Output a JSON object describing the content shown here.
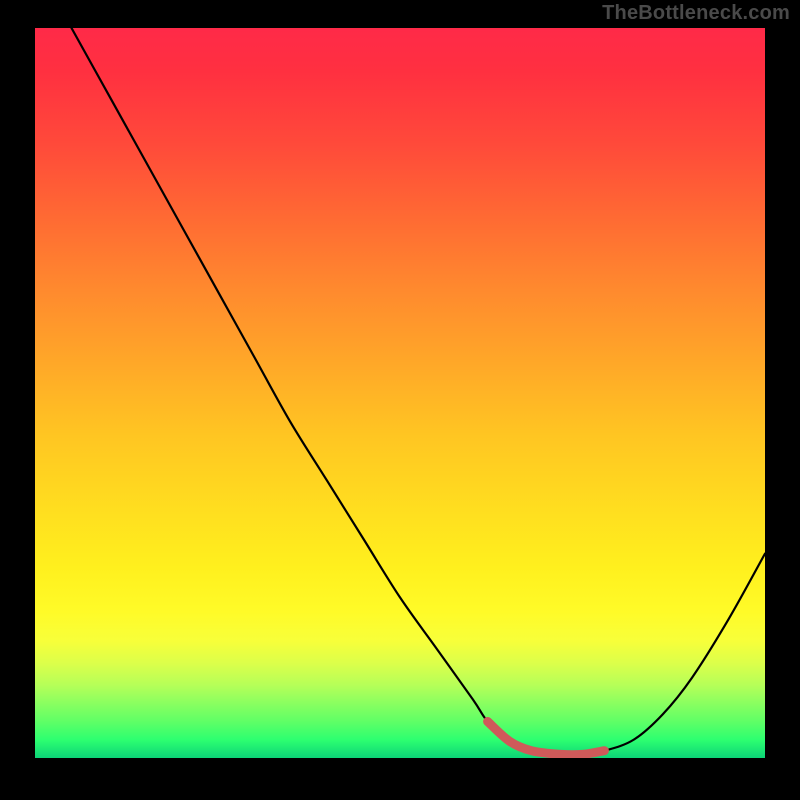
{
  "watermark": "TheBottleneck.com",
  "colors": {
    "background": "#000000",
    "gradient_top": "#ff2a48",
    "gradient_bottom": "#0cd477",
    "curve": "#000000",
    "trough_highlight": "#cf5a5a"
  },
  "chart_data": {
    "type": "line",
    "title": "",
    "xlabel": "",
    "ylabel": "",
    "xlim": [
      0,
      100
    ],
    "ylim": [
      0,
      100
    ],
    "x": [
      5,
      10,
      15,
      20,
      25,
      30,
      35,
      40,
      45,
      50,
      55,
      60,
      62,
      65,
      68,
      72,
      75,
      78,
      82,
      86,
      90,
      95,
      100
    ],
    "values": [
      100,
      91,
      82,
      73,
      64,
      55,
      46,
      38,
      30,
      22,
      15,
      8,
      5,
      2.3,
      1.0,
      0.5,
      0.5,
      1.0,
      2.5,
      6,
      11,
      19,
      28
    ],
    "trough_segment": {
      "x": [
        62,
        65,
        68,
        72,
        75,
        78
      ],
      "values": [
        5,
        2.3,
        1.0,
        0.5,
        0.5,
        1.0
      ]
    }
  }
}
